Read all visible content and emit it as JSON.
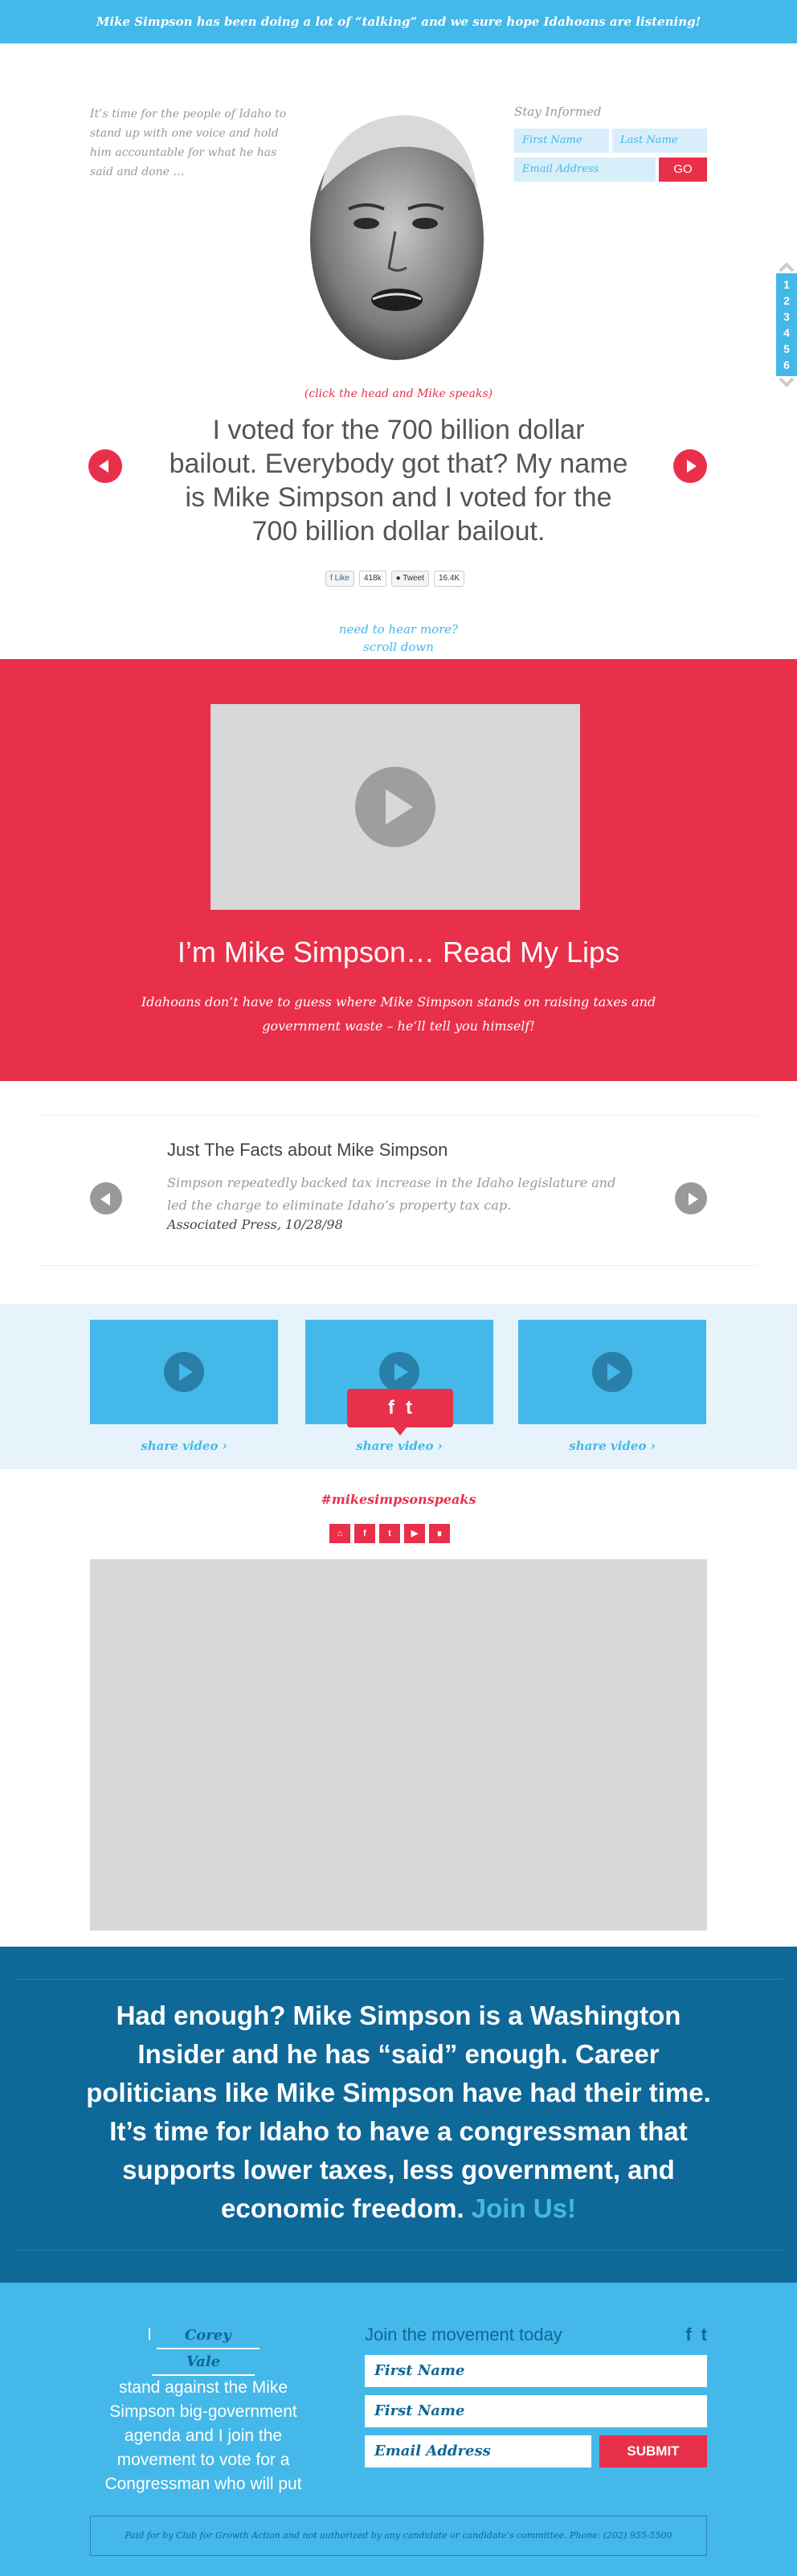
{
  "banner": {
    "text": "Mike Simpson has been doing a lot of “talking” and we sure hope Idahoans are listening!"
  },
  "hero": {
    "intro": "It’s time for the people of Idaho to stand up with one voice and hold him accountable for what he has said and done …",
    "click_hint": "(click the head and Mike speaks)",
    "quote": "I voted for the 700 billion dollar bailout. Everybody got that? My name is Mike Simpson and I voted for the 700 billion dollar bailout.",
    "scroll_hint_1": "need to hear more?",
    "scroll_hint_2": "scroll down"
  },
  "social": {
    "like_label": "Like",
    "like_count": "418k",
    "tweet_label": "Tweet",
    "tweet_count": "16.4K"
  },
  "stay_informed": {
    "label": "Stay Informed",
    "first_name_placeholder": "First Name",
    "last_name_placeholder": "Last Name",
    "email_placeholder": "Email Address",
    "go_label": "GO"
  },
  "pager": {
    "pages": [
      "1",
      "2",
      "3",
      "4",
      "5",
      "6"
    ]
  },
  "read_my_lips": {
    "title": "I’m Mike Simpson… Read My Lips",
    "subtitle": "Idahoans don’t have to guess where Mike Simpson stands on raising taxes and government waste – he’ll tell you himself!"
  },
  "facts": {
    "title": "Just The Facts about Mike Simpson",
    "body": "Simpson repeatedly backed tax increase in the Idaho legislature and led the charge to eliminate Idaho’s property tax cap.",
    "source": "Associated Press, 10/28/98"
  },
  "videos": {
    "share_label": "share video ›",
    "share_facebook": "f",
    "share_twitter": "t"
  },
  "hashtag": {
    "text": "#mikesimpsonspeaks",
    "icons": [
      "home-icon",
      "facebook-icon",
      "twitter-icon",
      "youtube-icon",
      "rss-icon"
    ]
  },
  "enough": {
    "text": "Had enough? Mike Simpson is a Washington Insider and he has “said” enough. Career politicians like Mike Simpson have had their time. It’s time for Idaho to have a congressman that supports lower taxes, less government, and economic freedom.",
    "join": "Join Us!"
  },
  "pledge": {
    "i": "I",
    "first": "Corey",
    "last": "Vale",
    "text": "stand against the Mike Simpson big-government agenda and I join the movement to vote for a Congressman who will put"
  },
  "movement": {
    "title": "Join the movement today",
    "first_name": "First Name",
    "last_name": "First Name",
    "email": "Email Address",
    "submit": "SUBMIT"
  },
  "disclaimer": "Paid for by Club for Growth Action and not authorized by any candidate or candidate’s committee. Phone: (202) 955-5500",
  "colors": {
    "brand_blue": "#44b8e8",
    "accent_red": "#e8304a",
    "dark_blue": "#0e6898"
  }
}
